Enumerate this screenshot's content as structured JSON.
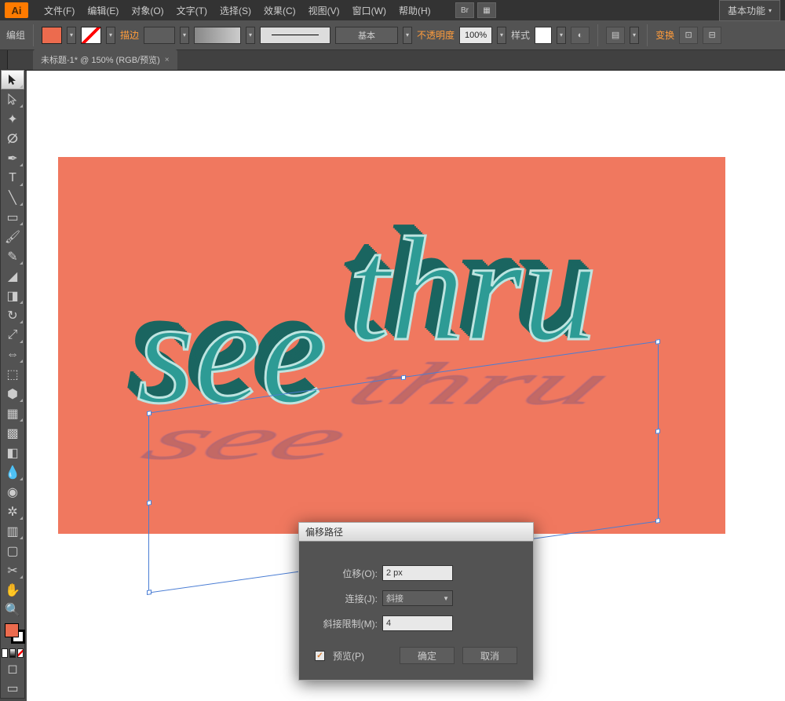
{
  "menu": {
    "items": [
      "文件(F)",
      "编辑(E)",
      "对象(O)",
      "文字(T)",
      "选择(S)",
      "效果(C)",
      "视图(V)",
      "窗口(W)",
      "帮助(H)"
    ],
    "workspace": "基本功能"
  },
  "controlbar": {
    "mode_label": "编组",
    "stroke_label": "描边",
    "stroke_basic": "基本",
    "opacity_label": "不透明度",
    "opacity_value": "100%",
    "style_label": "样式",
    "transform_label": "变换",
    "fill_color": "#ec6b4e"
  },
  "doc_tab": {
    "title": "未标题-1* @ 150% (RGB/预览)",
    "close": "×"
  },
  "artwork": {
    "word1": "see",
    "word2": "thru"
  },
  "dialog": {
    "title": "偏移路径",
    "offset_label": "位移(O):",
    "offset_value": "2 px",
    "join_label": "连接(J):",
    "join_value": "斜接",
    "miter_label": "斜接限制(M):",
    "miter_value": "4",
    "preview_label": "预览(P)",
    "ok": "确定",
    "cancel": "取消"
  },
  "tools": [
    "selection",
    "direct-selection",
    "magic-wand",
    "lasso",
    "pen",
    "type",
    "line",
    "rectangle",
    "paintbrush",
    "pencil",
    "blob-brush",
    "eraser",
    "rotate",
    "scale",
    "width",
    "free-transform",
    "shape-builder",
    "perspective",
    "mesh",
    "gradient",
    "eyedropper",
    "blend",
    "symbol-sprayer",
    "column-graph",
    "artboard",
    "slice",
    "hand",
    "zoom"
  ]
}
